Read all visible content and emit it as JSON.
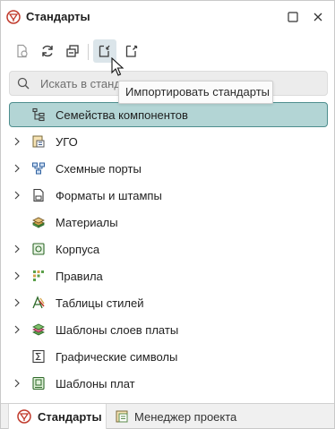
{
  "window": {
    "title": "Стандарты"
  },
  "toolbar": {
    "buttons": [
      {
        "name": "standards-db-icon"
      },
      {
        "name": "refresh-icon"
      },
      {
        "name": "collapse-all-icon"
      },
      {
        "name": "import-standards-icon"
      },
      {
        "name": "export-standards-icon"
      }
    ],
    "tooltip": "Импортировать стандарты"
  },
  "search": {
    "placeholder": "Искать в стандартах",
    "value": ""
  },
  "tree": {
    "items": [
      {
        "label": "Семейства компонентов",
        "icon": "component-families-icon",
        "expandable": false,
        "selected": true
      },
      {
        "label": "УГО",
        "icon": "ugo-icon",
        "expandable": true,
        "selected": false
      },
      {
        "label": "Схемные порты",
        "icon": "schematic-ports-icon",
        "expandable": true,
        "selected": false
      },
      {
        "label": "Форматы и штампы",
        "icon": "formats-stamps-icon",
        "expandable": true,
        "selected": false
      },
      {
        "label": "Материалы",
        "icon": "materials-icon",
        "expandable": false,
        "selected": false
      },
      {
        "label": "Корпуса",
        "icon": "packages-icon",
        "expandable": true,
        "selected": false
      },
      {
        "label": "Правила",
        "icon": "rules-icon",
        "expandable": true,
        "selected": false
      },
      {
        "label": "Таблицы стилей",
        "icon": "style-tables-icon",
        "expandable": true,
        "selected": false
      },
      {
        "label": "Шаблоны слоев платы",
        "icon": "board-layer-templates-icon",
        "expandable": true,
        "selected": false
      },
      {
        "label": "Графические символы",
        "icon": "graphic-symbols-icon",
        "expandable": false,
        "selected": false
      },
      {
        "label": "Шаблоны плат",
        "icon": "board-templates-icon",
        "expandable": true,
        "selected": false
      }
    ]
  },
  "tabs": [
    {
      "label": "Стандарты",
      "active": true
    },
    {
      "label": "Менеджер проекта",
      "active": false
    }
  ],
  "colors": {
    "accent": "#4e8e8e",
    "selection": "#b3d5d5",
    "brand_red": "#c0392b"
  }
}
